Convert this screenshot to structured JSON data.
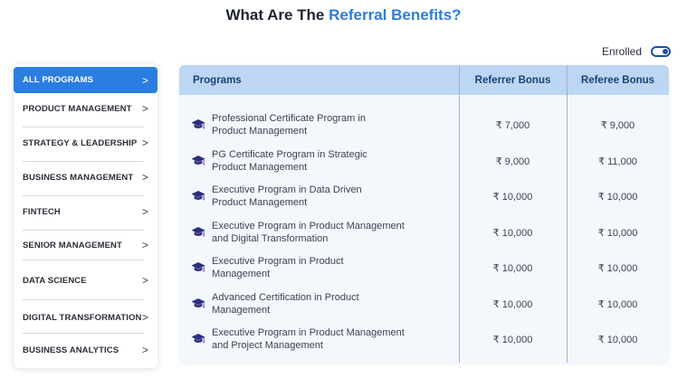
{
  "heading": {
    "prefix": "What Are The ",
    "accent": "Referral Benefits?"
  },
  "toggle": {
    "label": "Enrolled",
    "state": "on"
  },
  "colors": {
    "accent": "#2a7de1",
    "header_bg": "#bcd6f4",
    "header_text": "#1d3f78",
    "table_bg": "#f4f8fd"
  },
  "sidebar": {
    "chevron": ">",
    "items": [
      {
        "label": "ALL PROGRAMS",
        "active": true
      },
      {
        "label": "PRODUCT MANAGEMENT"
      },
      {
        "label": "STRATEGY & LEADERSHIP"
      },
      {
        "label": "BUSINESS MANAGEMENT"
      },
      {
        "label": "FINTECH"
      },
      {
        "label": "SENIOR MANAGEMENT"
      },
      {
        "label": "DATA SCIENCE"
      },
      {
        "label": "DIGITAL TRANSFORMATION"
      },
      {
        "label": "BUSINESS ANALYTICS"
      }
    ]
  },
  "table": {
    "icon": "graduation-cap-icon",
    "headers": {
      "program": "Programs",
      "referrer": "Referrer Bonus",
      "referee": "Referee Bonus"
    },
    "rows": [
      {
        "line1": "Professional Certificate Program in",
        "line2": "Product Management",
        "referrer": "₹ 7,000",
        "referee": "₹ 9,000"
      },
      {
        "line1": "PG Certificate Program in Strategic",
        "line2": "Product Management",
        "referrer": "₹ 9,000",
        "referee": "₹ 11,000"
      },
      {
        "line1": "Executive Program in Data Driven",
        "line2": "Product Management",
        "referrer": "₹ 10,000",
        "referee": "₹ 10,000"
      },
      {
        "line1": "Executive Program in Product Management",
        "line2": "and Digital Transformation",
        "referrer": "₹ 10,000",
        "referee": "₹ 10,000"
      },
      {
        "line1": "Executive Program in Product",
        "line2": "Management",
        "referrer": "₹ 10,000",
        "referee": "₹ 10,000"
      },
      {
        "line1": "Advanced Certification in Product",
        "line2": "Management",
        "referrer": "₹ 10,000",
        "referee": "₹ 10,000"
      },
      {
        "line1": "Executive Program in Product Management",
        "line2": "and Project Management",
        "referrer": "₹ 10,000",
        "referee": "₹ 10,000"
      }
    ]
  }
}
